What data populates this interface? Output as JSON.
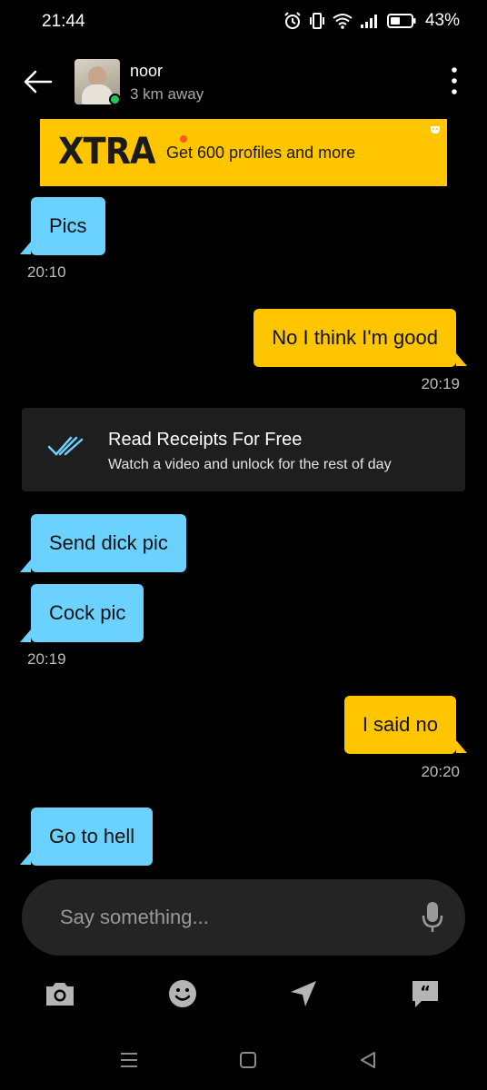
{
  "status_bar": {
    "time": "21:44",
    "battery": "43%",
    "icons": [
      "alarm-icon",
      "vibrate-icon",
      "wifi-icon",
      "signal-icon",
      "battery-icon"
    ]
  },
  "header": {
    "contact_name": "noor",
    "distance": "3 km away",
    "online": true
  },
  "banner": {
    "logo": "XTRA",
    "text": "Get 600 profiles and more"
  },
  "messages": [
    {
      "direction": "in",
      "text": "Pics",
      "time": "20:10"
    },
    {
      "direction": "out",
      "text": "No I think I'm good",
      "time": "20:19"
    },
    {
      "direction": "in",
      "text": "Send dick pic"
    },
    {
      "direction": "in",
      "text": "Cock pic",
      "time": "20:19"
    },
    {
      "direction": "out",
      "text": "I said no",
      "time": "20:20"
    },
    {
      "direction": "in",
      "text": "Go to hell"
    }
  ],
  "read_receipts_card": {
    "title": "Read Receipts For Free",
    "subtitle": "Watch a video and unlock for the rest of day"
  },
  "composer": {
    "placeholder": "Say something..."
  },
  "toolbar": [
    "camera-icon",
    "emoji-icon",
    "location-icon",
    "quote-icon"
  ],
  "colors": {
    "accent_yellow": "#ffc600",
    "incoming_blue": "#6bd2ff",
    "background": "#000000"
  }
}
